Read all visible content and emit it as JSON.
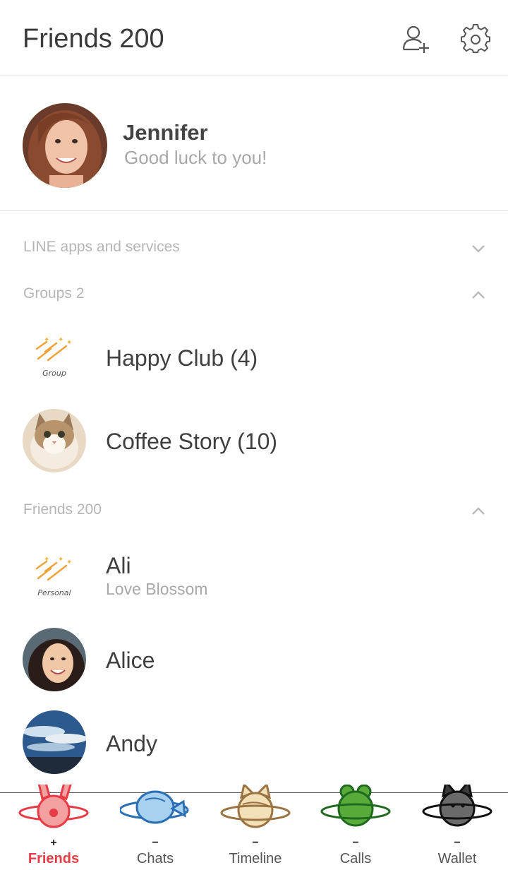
{
  "header": {
    "title": "Friends 200",
    "add_friend_icon": "add-friend-icon",
    "settings_icon": "gear-icon"
  },
  "profile": {
    "name": "Jennifer",
    "status": "Good luck to you!"
  },
  "sections": {
    "apps": {
      "label": "LINE apps and services",
      "state": "collapsed"
    },
    "groups": {
      "label": "Groups 2",
      "state": "expanded"
    },
    "friends": {
      "label": "Friends 200",
      "state": "expanded"
    }
  },
  "groups": [
    {
      "name": "Happy Club (4)",
      "avatar": "group-default",
      "avatar_caption": "Group"
    },
    {
      "name": "Coffee Story (10)",
      "avatar": "cat-photo"
    }
  ],
  "friends": [
    {
      "name": "Ali",
      "status": "Love Blossom",
      "avatar": "personal-default",
      "avatar_caption": "Personal"
    },
    {
      "name": "Alice",
      "status": "",
      "avatar": "woman-photo"
    },
    {
      "name": "Andy",
      "status": "",
      "avatar": "sky-photo"
    }
  ],
  "tabs": [
    {
      "label": "Friends",
      "mark": "+",
      "active": true,
      "color": "#e83b45"
    },
    {
      "label": "Chats",
      "mark": "−",
      "active": false,
      "color": "#3a8ed6"
    },
    {
      "label": "Timeline",
      "mark": "−",
      "active": false,
      "color": "#c9a062"
    },
    {
      "label": "Calls",
      "mark": "−",
      "active": false,
      "color": "#2f8a2f"
    },
    {
      "label": "Wallet",
      "mark": "−",
      "active": false,
      "color": "#4a4a4a"
    }
  ]
}
